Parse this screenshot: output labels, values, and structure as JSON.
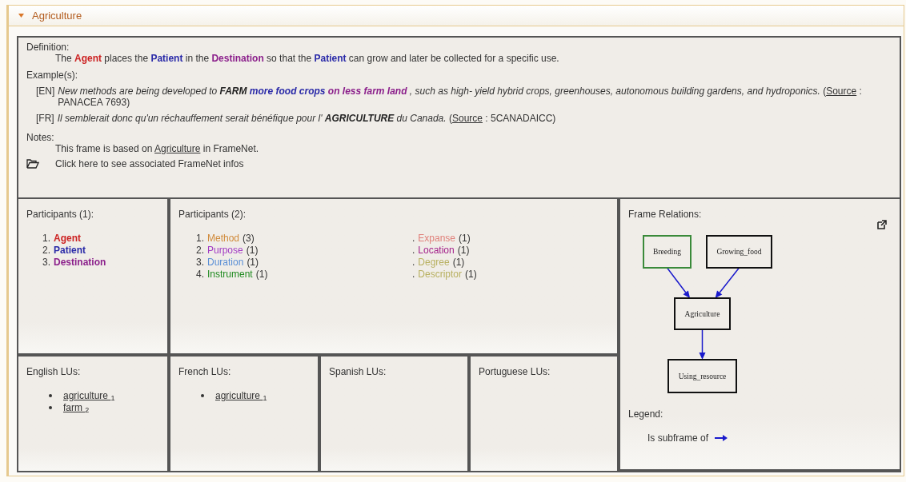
{
  "panel": {
    "title": "Agriculture",
    "expanded": true
  },
  "definition": {
    "label": "Definition:",
    "segments": [
      {
        "text": "The "
      },
      {
        "text": "Agent",
        "color": "#cc2222"
      },
      {
        "text": " places the "
      },
      {
        "text": "Patient",
        "color": "#2a2aa8"
      },
      {
        "text": " in the "
      },
      {
        "text": "Destination",
        "color": "#8b1f8b"
      },
      {
        "text": " so that the "
      },
      {
        "text": "Patient",
        "color": "#2a2aa8"
      },
      {
        "text": " can grow and later be collected for a specific use."
      }
    ]
  },
  "examples": {
    "label": "Example(s):",
    "items": [
      {
        "lang": "[EN]",
        "segments": [
          {
            "kind": "text",
            "text": "New methods are being developed to "
          },
          {
            "kind": "target",
            "text": "FARM"
          },
          {
            "kind": "fe",
            "text": " more food crops",
            "color": "#2a2aa8"
          },
          {
            "kind": "fe",
            "text": " on less farm land",
            "color": "#8b1f8b"
          },
          {
            "kind": "text",
            "text": " , such as high- yield hybrid crops, greenhouses, autonomous building gardens, and hydroponics. "
          },
          {
            "kind": "plain",
            "text": "("
          },
          {
            "kind": "link",
            "text": "Source"
          },
          {
            "kind": "plain",
            "text": " : PANACEA 7693)"
          }
        ]
      },
      {
        "lang": "[FR]",
        "segments": [
          {
            "kind": "text",
            "text": "Il semblerait donc qu'un réchauffement serait bénéfique pour l' "
          },
          {
            "kind": "target",
            "text": "AGRICULTURE"
          },
          {
            "kind": "text",
            "text": " du Canada. "
          },
          {
            "kind": "plain",
            "text": "("
          },
          {
            "kind": "link",
            "text": "Source"
          },
          {
            "kind": "plain",
            "text": " : 5CANADAICC)"
          }
        ]
      }
    ]
  },
  "notes": {
    "label": "Notes:",
    "before": "This frame is based on ",
    "link": "Agriculture",
    "after": " in FrameNet.",
    "framenet_link": "Click here to see associated FrameNet infos"
  },
  "core_participants": {
    "title": "Participants (1):",
    "items": [
      {
        "number": "1.",
        "name": "Agent",
        "color": "#cc2222"
      },
      {
        "number": "2.",
        "name": "Patient",
        "color": "#2a2aa8"
      },
      {
        "number": "3.",
        "name": "Destination",
        "color": "#8b1f8b"
      }
    ]
  },
  "other_participants": {
    "title": "Participants (2):",
    "columns": [
      [
        {
          "number": "1.",
          "name": "Method",
          "count": "(3)",
          "color": "#d08a3a"
        },
        {
          "number": "2.",
          "name": "Purpose",
          "count": "(1)",
          "color": "#a23bc4"
        },
        {
          "number": "3.",
          "name": "Duration",
          "count": "(1)",
          "color": "#5a8fd6"
        },
        {
          "number": "4.",
          "name": "Instrument",
          "count": "(1)",
          "color": "#1f8a1f"
        }
      ],
      [
        {
          "number": ".",
          "name": "Expanse",
          "count": "(1)",
          "color": "#e0807a"
        },
        {
          "number": ".",
          "name": "Location",
          "count": "(1)",
          "color": "#a3208a"
        },
        {
          "number": ".",
          "name": "Degree",
          "count": "(1)",
          "color": "#b8b060"
        },
        {
          "number": ".",
          "name": "Descriptor",
          "count": "(1)",
          "color": "#b8b060"
        }
      ]
    ]
  },
  "lus": [
    {
      "title": "English LUs:",
      "items": [
        {
          "name": "agriculture",
          "index": "1"
        },
        {
          "name": "farm",
          "index": "2"
        }
      ]
    },
    {
      "title": "French LUs:",
      "items": [
        {
          "name": "agriculture",
          "index": "1"
        }
      ]
    },
    {
      "title": "Spanish LUs:"
    },
    {
      "title": "Portuguese LUs:"
    }
  ],
  "frame_relations": {
    "title": "Frame Relations:",
    "nodes": [
      {
        "label": "Breeding",
        "color": "#3a8a3a"
      },
      {
        "label": "Growing_food",
        "color": "#111111"
      },
      {
        "label": "Agriculture",
        "color": "#111111"
      },
      {
        "label": "Using_resource",
        "color": "#111111"
      }
    ],
    "edges": [
      {
        "color": "#1a1acc"
      },
      {
        "color": "#1a1acc"
      },
      {
        "color": "#1a1acc"
      }
    ],
    "legend": {
      "title": "Legend:",
      "items": [
        {
          "label": "Is subframe of",
          "color": "#1a1acc"
        }
      ]
    }
  }
}
